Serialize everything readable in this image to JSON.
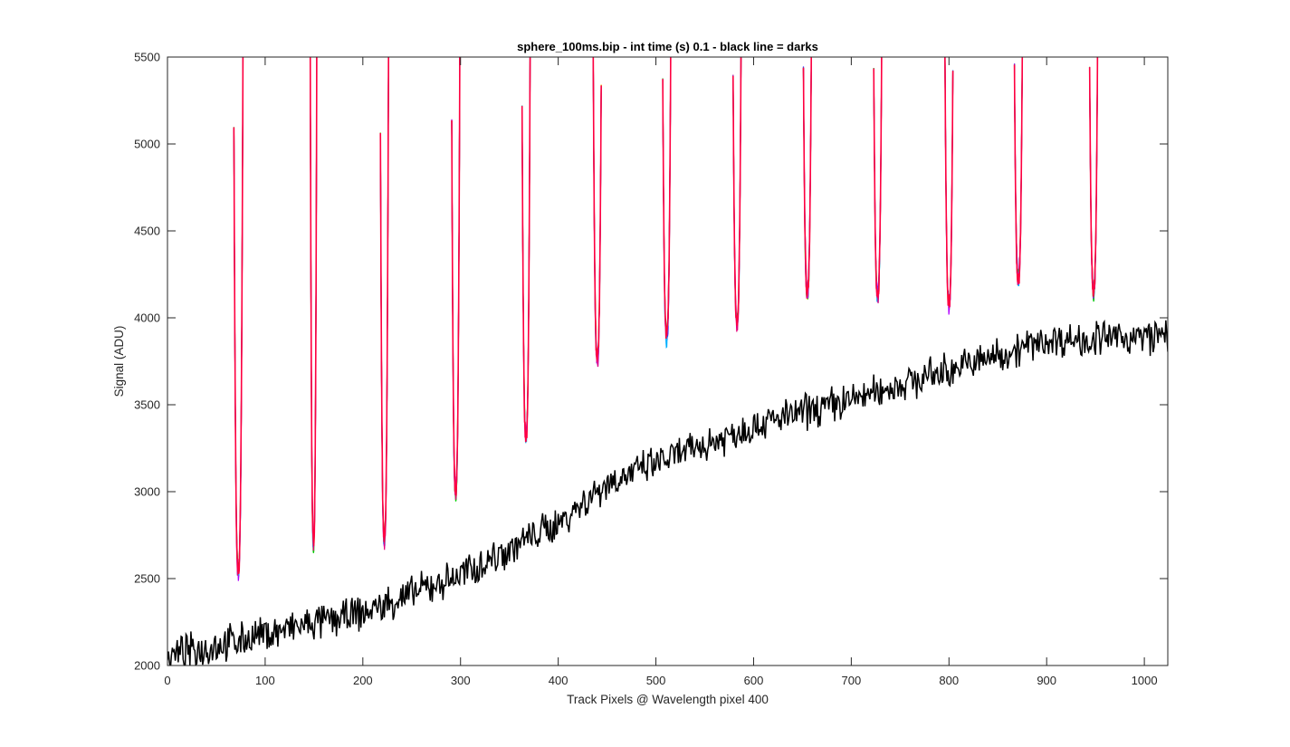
{
  "chart_data": {
    "type": "line",
    "title": "sphere_100ms.bip - int time (s) 0.1 - black line = darks",
    "xlabel": "Track Pixels @ Wavelength pixel 400",
    "ylabel": "Signal (ADU)",
    "xlim": [
      0,
      1024
    ],
    "ylim": [
      2000,
      5500
    ],
    "xticks": [
      0,
      100,
      200,
      300,
      400,
      500,
      600,
      700,
      800,
      900,
      1000
    ],
    "yticks": [
      2000,
      2500,
      3000,
      3500,
      4000,
      4500,
      5000,
      5500
    ],
    "grid": false,
    "colors": {
      "darks": "#000000",
      "frames": [
        "#ff0040",
        "#e6007a",
        "#0000ff",
        "#00cc00",
        "#ffcc00",
        "#b000ff",
        "#00b0ff"
      ],
      "axes": "#262626"
    },
    "series": [
      {
        "key": "frames",
        "style": "signal dips between saturated regions (multiple overlapping frames)",
        "dips": [
          {
            "left": 68,
            "right": 78,
            "center": 72.5,
            "min": 2530
          },
          {
            "left": 146,
            "right": 153,
            "center": 149.5,
            "min": 2690
          },
          {
            "left": 218,
            "right": 227,
            "center": 222,
            "min": 2710
          },
          {
            "left": 291,
            "right": 300,
            "center": 295,
            "min": 2990
          },
          {
            "left": 363,
            "right": 372,
            "center": 367,
            "min": 3300
          },
          {
            "left": 435,
            "right": 444,
            "center": 440,
            "min": 3750
          },
          {
            "left": 507,
            "right": 516,
            "center": 511,
            "min": 3890
          },
          {
            "left": 579,
            "right": 588,
            "center": 583,
            "min": 3960
          },
          {
            "left": 651,
            "right": 660,
            "center": 655,
            "min": 4140
          },
          {
            "left": 723,
            "right": 732,
            "center": 727,
            "min": 4120
          },
          {
            "left": 795,
            "right": 804,
            "center": 800,
            "min": 4070
          },
          {
            "left": 867,
            "right": 876,
            "center": 871,
            "min": 4200
          },
          {
            "left": 944,
            "right": 953,
            "center": 948,
            "min": 4150
          }
        ]
      },
      {
        "key": "darks",
        "style": "noisy dark-frame trace",
        "x_step": 1,
        "trend": [
          [
            0,
            2050
          ],
          [
            100,
            2180
          ],
          [
            200,
            2300
          ],
          [
            300,
            2520
          ],
          [
            400,
            2820
          ],
          [
            450,
            3050
          ],
          [
            500,
            3160
          ],
          [
            600,
            3380
          ],
          [
            700,
            3530
          ],
          [
            800,
            3700
          ],
          [
            900,
            3870
          ],
          [
            1000,
            3890
          ],
          [
            1024,
            3900
          ]
        ],
        "noise_amplitude": 80,
        "seed": 7
      }
    ]
  }
}
